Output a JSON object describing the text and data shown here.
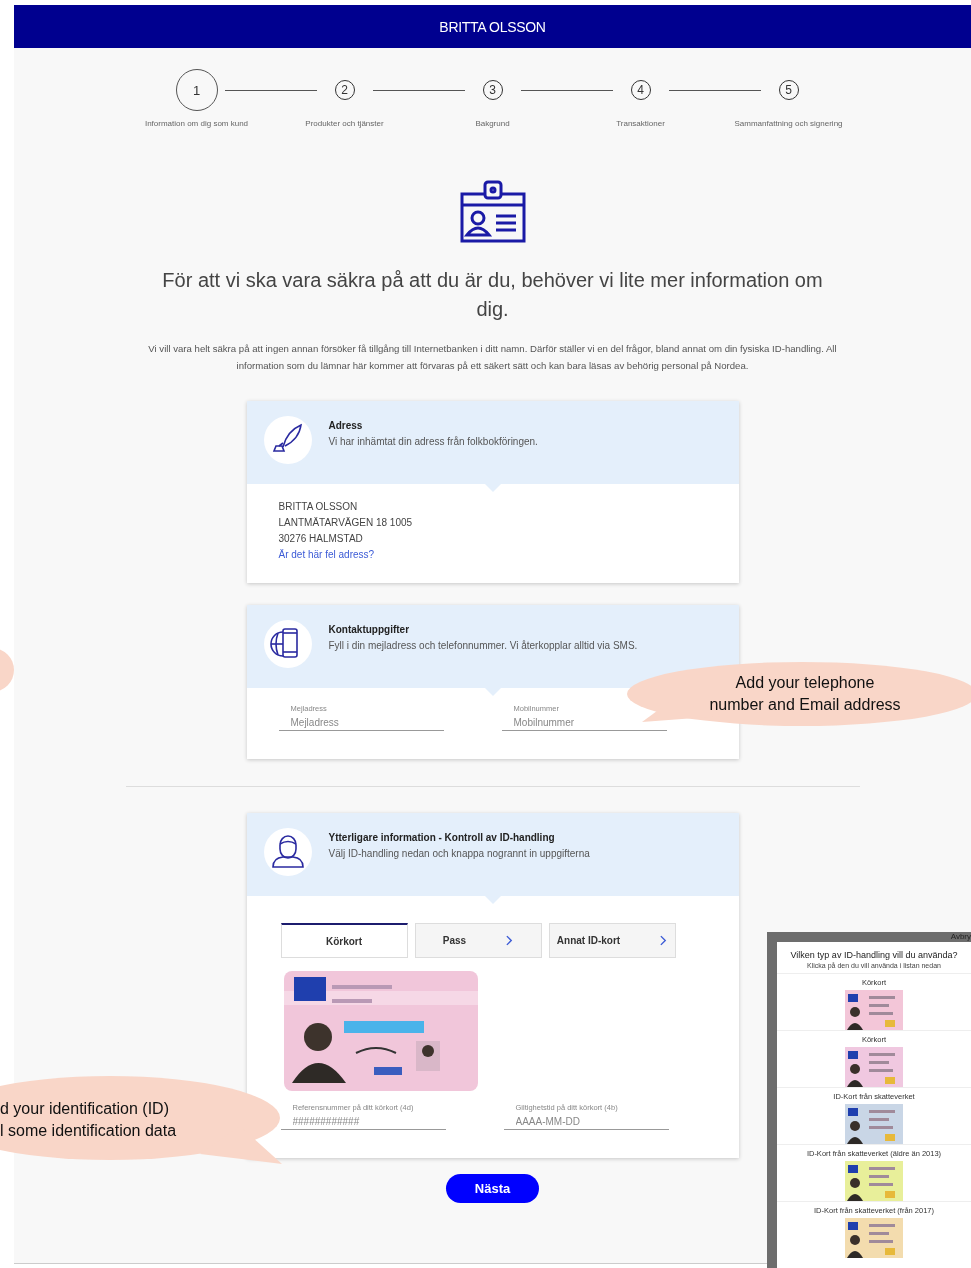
{
  "header": {
    "title": "BRITTA OLSSON"
  },
  "steps": [
    {
      "number": "1",
      "label": "Information om dig som kund",
      "selected": true
    },
    {
      "number": "2",
      "label": "Produkter och tjänster",
      "selected": false
    },
    {
      "number": "3",
      "label": "Bakgrund",
      "selected": false
    },
    {
      "number": "4",
      "label": "Transaktioner",
      "selected": false
    },
    {
      "number": "5",
      "label": "Sammanfattning och signering",
      "selected": false
    }
  ],
  "heading": "För att vi ska vara säkra på att du är du, behöver vi lite mer information om dig.",
  "intro": "Vi vill vara helt säkra på att ingen annan försöker få tillgång till Internetbanken i ditt namn. Därför ställer vi en del frågor, bland annat om din fysiska ID-handling. All information som du lämnar här kommer att förvaras på ett säkert sätt och kan bara läsas av behörig personal på Nordea.",
  "address_card": {
    "title": "Adress",
    "subtitle": "Vi har inhämtat din adress från folkbokföringen.",
    "lines": [
      "BRITTA OLSSON",
      "LANTMÄTARVÄGEN 18 1005",
      "30276 HALMSTAD"
    ],
    "link": "Är det här fel adress?"
  },
  "contact_card": {
    "title": "Kontaktuppgifter",
    "subtitle": "Fyll i din mejladress och telefonnummer. Vi återkopplar alltid via SMS.",
    "fields": [
      {
        "label": "Mejladress",
        "placeholder": "Mejladress"
      },
      {
        "label": "Mobilnummer",
        "placeholder": "Mobilnummer"
      }
    ]
  },
  "id_card": {
    "title": "Ytterligare information - Kontroll av ID-handling",
    "subtitle": "Välj ID-handling nedan och knappa nogrannt in uppgifterna",
    "tabs": [
      {
        "label": "Körkort",
        "selected": true
      },
      {
        "label": "Pass",
        "selected": false
      },
      {
        "label": "Annat ID-kort",
        "selected": false
      }
    ],
    "fields": [
      {
        "label": "Referensnummer på ditt körkort (4d)",
        "placeholder": "############"
      },
      {
        "label": "Giltighetstid på ditt körkort (4b)",
        "placeholder": "AAAA-MM-DD"
      }
    ]
  },
  "next_button": "Nästa",
  "callouts": [
    {
      "lines": [
        "Add your telephone",
        "number and Email address"
      ]
    },
    {
      "lines": [
        "d your identification (ID)",
        "l some identification data"
      ]
    }
  ],
  "id_picker": {
    "cancel": "Avbry",
    "title": "Vilken typ av ID-handling vill du använda?",
    "subtitle": "Klicka på den du vill använda i listan nedan",
    "items": [
      {
        "label": "Körkort"
      },
      {
        "label": "Körkort"
      },
      {
        "label": "ID-Kort från skatteverket"
      },
      {
        "label": "ID-Kort från skatteverket (äldre än 2013)"
      },
      {
        "label": "ID-Kort från skatteverket (från 2017)"
      }
    ]
  }
}
